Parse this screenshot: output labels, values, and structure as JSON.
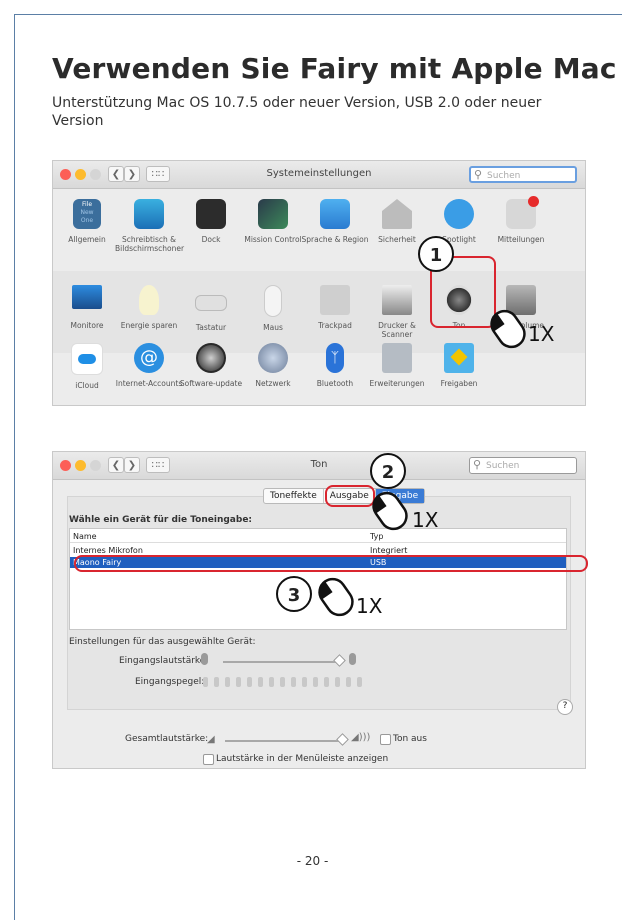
{
  "heading": "Verwenden Sie Fairy mit Apple Mac",
  "subtitle": "Unterstützung Mac OS 10.7.5 oder neuer Version, USB 2.0 oder neuer Version",
  "prefs": {
    "title": "Systemeinstellungen",
    "search_placeholder": "Suchen",
    "row1": [
      "Allgemein",
      "Schreibtisch & Bildschirmschoner",
      "Dock",
      "Mission Control",
      "Sprache & Region",
      "Sicherheit",
      "Spotlight",
      "Mitteilungen"
    ],
    "row2": [
      "Monitore",
      "Energie sparen",
      "Tastatur",
      "Maus",
      "Trackpad",
      "Drucker & Scanner",
      "Ton",
      "Startvolume"
    ],
    "row3": [
      "iCloud",
      "Internet-Accounts",
      "Software-update",
      "Netzwerk",
      "Bluetooth",
      "Erweiterungen",
      "Freigaben"
    ],
    "icon_file_text": [
      "File",
      "New",
      "One"
    ],
    "step_number": "1",
    "click_label": "1X"
  },
  "sound": {
    "title": "Ton",
    "search_placeholder": "Suchen",
    "tabs": [
      "Toneffekte",
      "Ausgabe",
      "Eingabe"
    ],
    "select_label": "Wähle ein Gerät für die Toneingabe:",
    "columns": [
      "Name",
      "Typ"
    ],
    "devices": [
      {
        "name": "Internes Mikrofon",
        "type": "Integriert"
      },
      {
        "name": "Maono Fairy",
        "type": "USB"
      }
    ],
    "settings_label": "Einstellungen für das ausgewählte Gerät:",
    "input_volume_label": "Eingangslautstärke:",
    "input_level_label": "Eingangspegel:",
    "output_volume_label": "Gesamtlautstärke:",
    "mute_label": "Ton aus",
    "menu_bar_label": "Lautstärke in der Menüleiste anzeigen",
    "help": "?",
    "step2": "2",
    "step3": "3",
    "click_label": "1X"
  },
  "page_number": "- 20 -"
}
